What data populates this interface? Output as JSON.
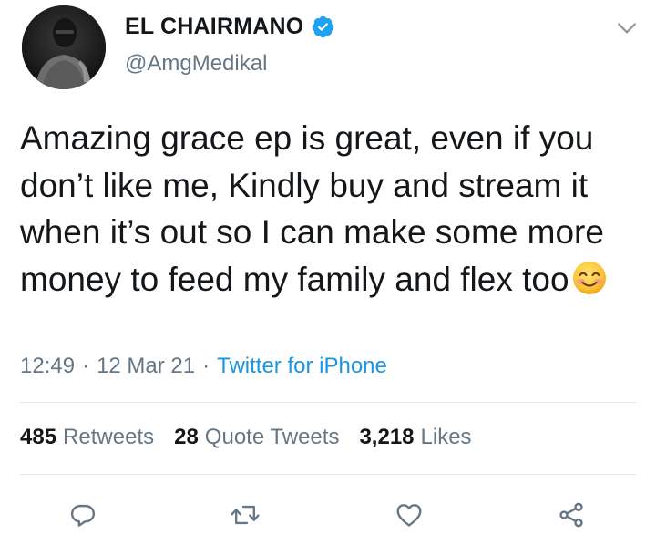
{
  "author": {
    "display_name": "EL CHAIRMANO",
    "handle": "@AmgMedikal",
    "verified": true
  },
  "tweet": {
    "text": "Amazing grace ep is great, even if you don’t like me, Kindly buy and stream it when it’s out so I can make some more money to feed my family and flex too",
    "emoji": "smiling-face-with-smiling-eyes"
  },
  "meta": {
    "time": "12:49",
    "separator": "·",
    "date": "12 Mar 21",
    "source": "Twitter for iPhone"
  },
  "stats": {
    "retweets_count": "485",
    "retweets_label": "Retweets",
    "quotes_count": "28",
    "quotes_label": "Quote Tweets",
    "likes_count": "3,218",
    "likes_label": "Likes"
  },
  "icons": {
    "reply": "reply-icon",
    "retweet": "retweet-icon",
    "like": "like-icon",
    "share": "share-icon",
    "menu": "chevron-down-icon",
    "verified": "verified-badge-icon"
  },
  "colors": {
    "text": "#14171a",
    "secondary": "#657786",
    "accent": "#1b95e0",
    "verified": "#1da1f2",
    "divider": "#e1e8ed"
  }
}
